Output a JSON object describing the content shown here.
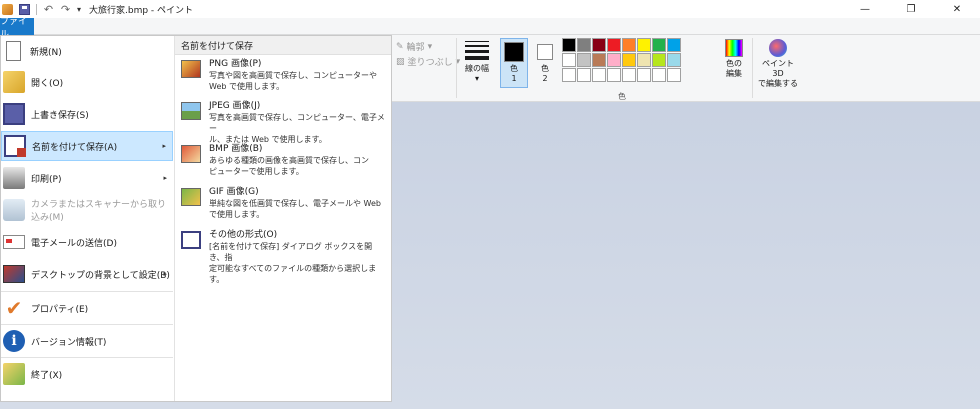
{
  "titlebar": {
    "title": "大旅行家.bmp - ペイント",
    "minimize": "—",
    "restore": "❐",
    "close": "✕",
    "qat": [
      "app-icon",
      "save-icon",
      "undo-icon",
      "redo-icon",
      "customize-icon"
    ]
  },
  "tabs": {
    "file": "ファイル"
  },
  "ribbon": {
    "outline": "輪郭",
    "fill": "塗りつぶし",
    "line_width_1": "線の幅",
    "line_width_2": "▾",
    "color1_1": "色",
    "color1_2": "1",
    "color2_1": "色",
    "color2_2": "2",
    "edit_colors_1": "色の",
    "edit_colors_2": "編集",
    "paint3d_1": "ペイント 3D",
    "paint3d_2": "で編集する",
    "group_colors": "色",
    "palette": [
      "#000000",
      "#7f7f7f",
      "#880015",
      "#ed1c24",
      "#ff7f27",
      "#fff200",
      "#22b14c",
      "#00a2e8",
      "#3f48cc",
      "#a349a4",
      "#ffffff",
      "#c3c3c3",
      "#b97a57",
      "#ffaec9",
      "#ffc90e",
      "#efe4b0",
      "#b5e61d",
      "#99d9ea",
      "#7092be",
      "#c8bfe7",
      "#ffffff",
      "#ffffff",
      "#ffffff",
      "#ffffff",
      "#ffffff",
      "#ffffff",
      "#ffffff",
      "#ffffff",
      "#ffffff",
      "#ffffff"
    ]
  },
  "menu": {
    "items": [
      {
        "label": "新規(N)"
      },
      {
        "label": "開く(O)"
      },
      {
        "label": "上書き保存(S)"
      },
      {
        "label": "名前を付けて保存(A)"
      },
      {
        "label": "印刷(P)"
      },
      {
        "label": "カメラまたはスキャナーから取り込み(M)"
      },
      {
        "label": "電子メールの送信(D)"
      },
      {
        "label": "デスクトップの背景として設定(B)"
      },
      {
        "label": "プロパティ(E)"
      },
      {
        "label": "バージョン情報(T)"
      },
      {
        "label": "終了(X)"
      }
    ],
    "arrow": "▸"
  },
  "saveas": {
    "header": "名前を付けて保存",
    "options": [
      {
        "title": "PNG 画像(P)",
        "desc1": "写真や図を高画質で保存し、コンピューターや",
        "desc2": "Web で使用します。"
      },
      {
        "title": "JPEG 画像(J)",
        "desc1": "写真を高画質で保存し、コンピューター、電子メー",
        "desc2": "ル、または Web で使用します。"
      },
      {
        "title": "BMP 画像(B)",
        "desc1": "あらゆる種類の画像を高画質で保存し、コン",
        "desc2": "ピューターで使用します。"
      },
      {
        "title": "GIF 画像(G)",
        "desc1": "単純な図を低画質で保存し、電子メールや Web",
        "desc2": "で使用します。"
      },
      {
        "title": "その他の形式(O)",
        "desc1": "[名前を付けて保存] ダイアログ ボックスを開き、指",
        "desc2": "定可能なすべてのファイルの種類から選択します。"
      }
    ]
  }
}
